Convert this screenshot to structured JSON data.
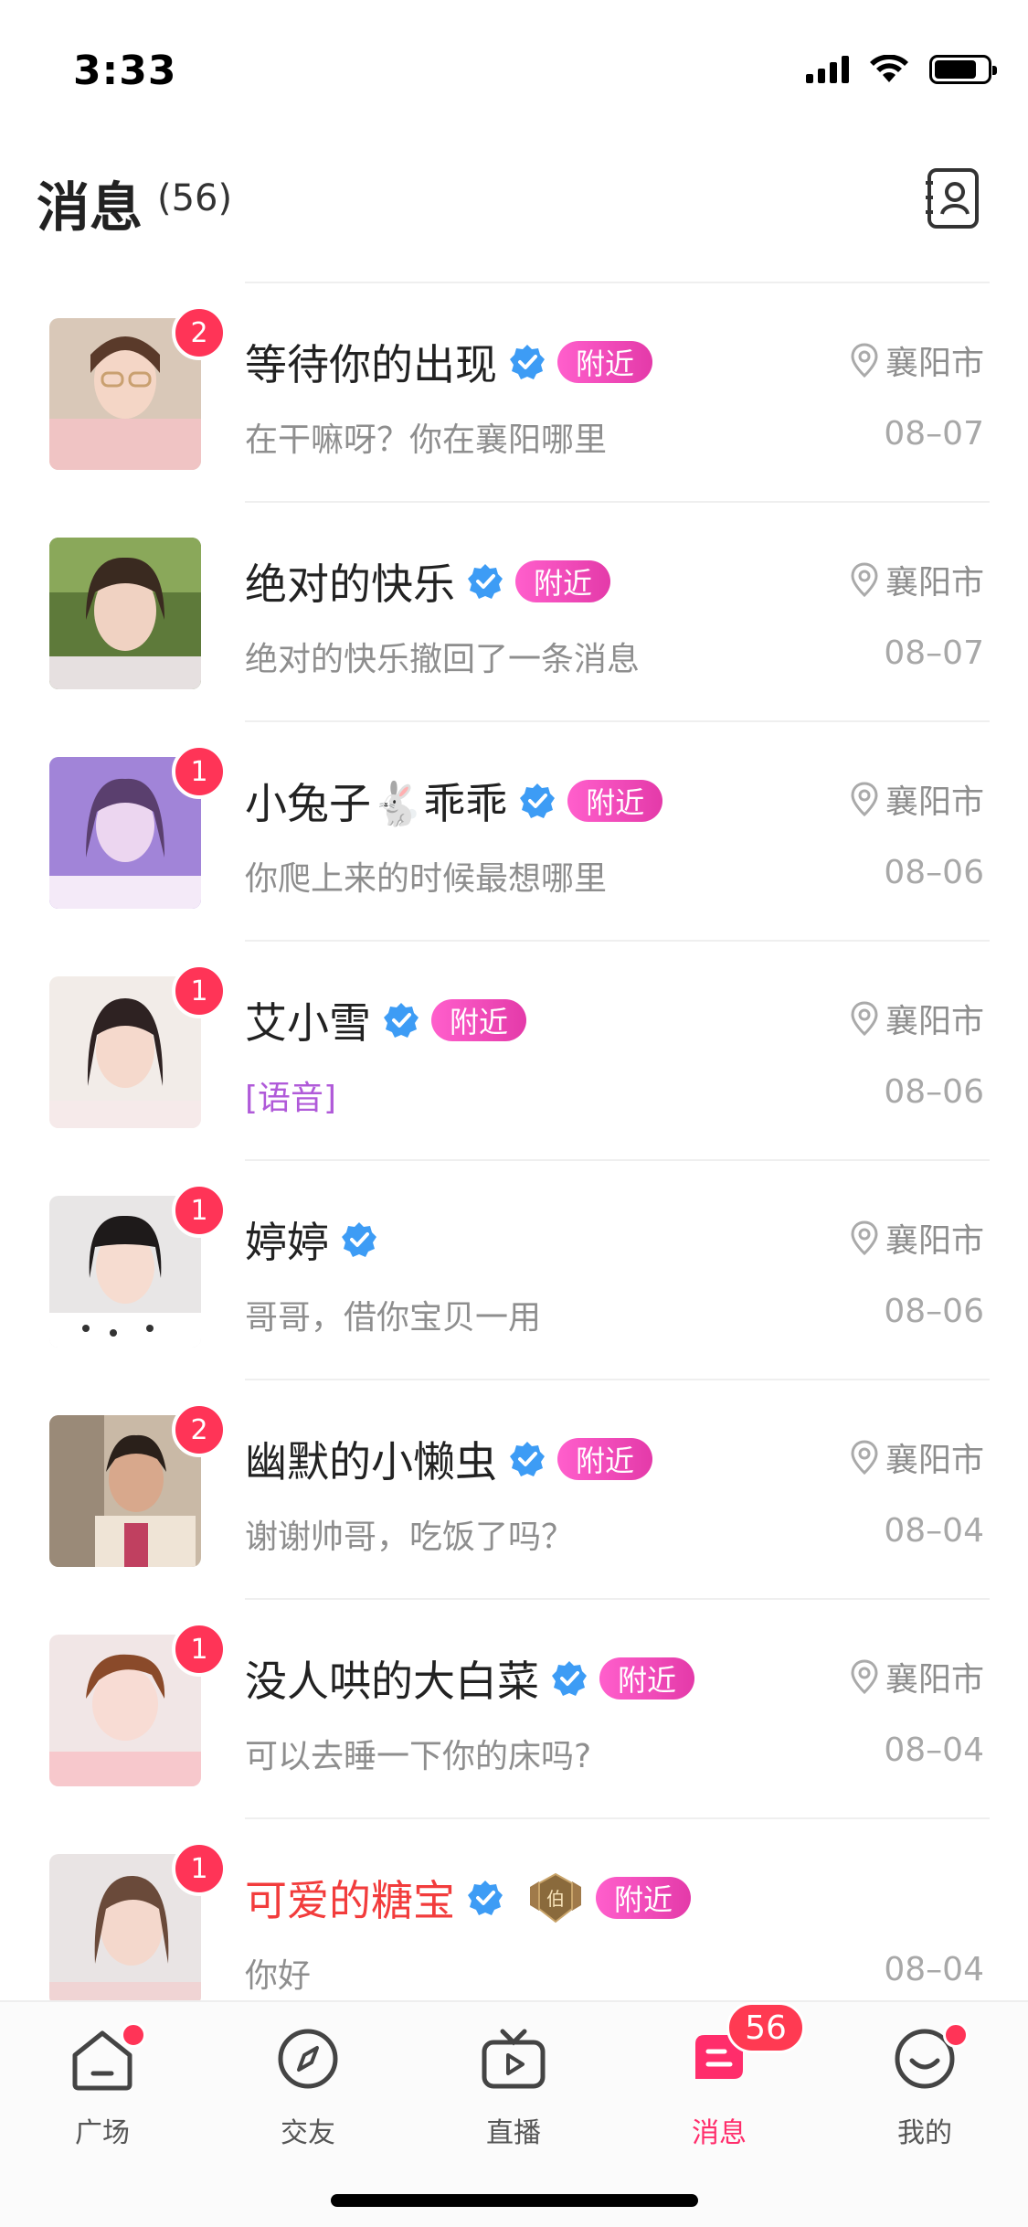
{
  "status_bar": {
    "time": "3:33"
  },
  "header": {
    "title": "消息",
    "count": "(56)"
  },
  "conversations": [
    {
      "name": "等待你的出现",
      "badge": "2",
      "nearby": "附近",
      "city": "襄阳市",
      "preview": "在干嘛呀？你在襄阳哪里",
      "date": "08–07"
    },
    {
      "name": "绝对的快乐",
      "badge": "",
      "nearby": "附近",
      "city": "襄阳市",
      "preview": "绝对的快乐撤回了一条消息",
      "date": "08–07"
    },
    {
      "name": "小兔子🐇乖乖",
      "badge": "1",
      "nearby": "附近",
      "city": "襄阳市",
      "preview": "你爬上来的时候最想哪里",
      "date": "08–06"
    },
    {
      "name": "艾小雪",
      "badge": "1",
      "nearby": "附近",
      "city": "襄阳市",
      "preview": "[语音]",
      "date": "08–06"
    },
    {
      "name": "婷婷",
      "badge": "1",
      "nearby": "",
      "city": "襄阳市",
      "preview": "哥哥，借你宝贝一用",
      "date": "08–06"
    },
    {
      "name": "幽默的小懒虫",
      "badge": "2",
      "nearby": "附近",
      "city": "襄阳市",
      "preview": "谢谢帅哥，吃饭了吗？",
      "date": "08–04"
    },
    {
      "name": "没人哄的大白菜",
      "badge": "1",
      "nearby": "附近",
      "city": "襄阳市",
      "preview": "可以去睡一下你的床吗?",
      "date": "08–04"
    },
    {
      "name": "可爱的糖宝",
      "badge": "1",
      "nearby": "附近",
      "city": "",
      "preview": "你好",
      "date": "08–04",
      "medal": "伯"
    }
  ],
  "tabs": [
    {
      "label": "广场",
      "icon": "home-icon"
    },
    {
      "label": "交友",
      "icon": "compass-icon"
    },
    {
      "label": "直播",
      "icon": "tv-icon"
    },
    {
      "label": "消息",
      "icon": "message-icon",
      "count": "56"
    },
    {
      "label": "我的",
      "icon": "smile-icon"
    }
  ],
  "colors": {
    "accent": "#ff2d6b",
    "badge": "#ff3457",
    "nearby_tag": "#f050c0",
    "verified": "#3d9cf5",
    "vip_name": "#f23c3c",
    "voice": "#b05ad9"
  }
}
